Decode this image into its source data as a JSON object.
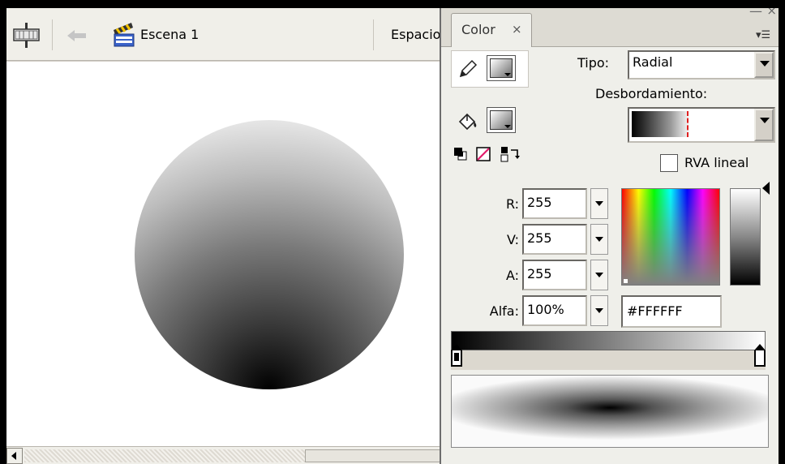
{
  "toolbar": {
    "scene_label": "Escena 1",
    "workspace_label": "Espacio"
  },
  "panel": {
    "tab_label": "Color",
    "tab_close": "×",
    "window_minimize": "—",
    "window_close": "×",
    "menu_icon": "▾☰",
    "tipo_label": "Tipo:",
    "tipo_value": "Radial",
    "desbordamiento_label": "Desbordamiento:",
    "rva_lineal_label": "RVA lineal",
    "rva_lineal_checked": false,
    "fields": {
      "r_label": "R:",
      "r_value": "255",
      "v_label": "V:",
      "v_value": "255",
      "a_label": "A:",
      "a_value": "255",
      "alfa_label": "Alfa:",
      "alfa_value": "100%"
    },
    "hex_value": "#FFFFFF",
    "gradient_stops": [
      {
        "color": "#000000",
        "position": 0,
        "selected": true
      },
      {
        "color": "#FFFFFF",
        "position": 1,
        "selected": false
      }
    ]
  },
  "icons": {
    "scene": "scene-icon",
    "back": "back-arrow-icon",
    "clapper": "clapperboard-icon",
    "pencil": "pencil-icon",
    "bucket": "paint-bucket-icon",
    "black_white": "black-white-icon",
    "no_color": "no-color-icon",
    "swap": "swap-colors-icon"
  },
  "colors": {
    "stage_bg": "#FFFFFF",
    "panel_bg": "#EFEFEA",
    "toolbar_bg": "#F0EFE9"
  }
}
